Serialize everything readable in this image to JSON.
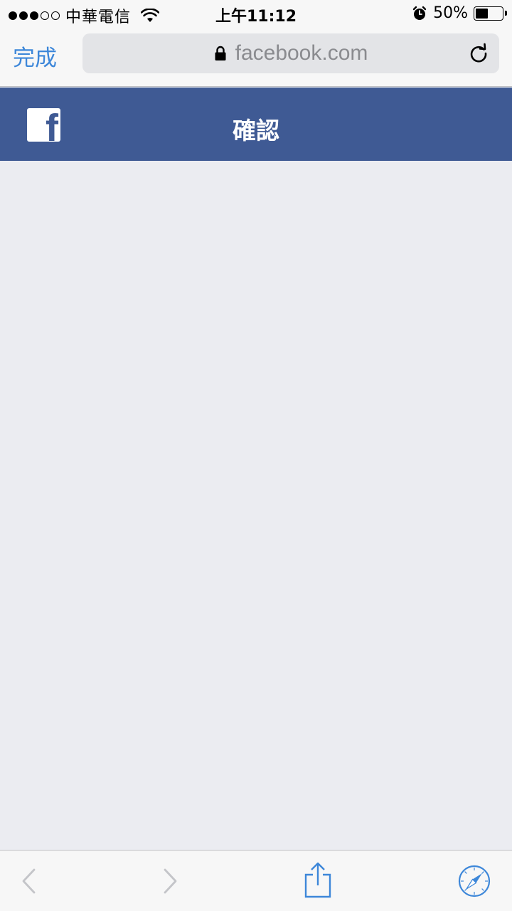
{
  "status_bar": {
    "carrier": "中華電信",
    "time": "上午11:12",
    "battery_percent": "50%",
    "battery_level": 0.5,
    "signal_bars_filled": 3,
    "signal_bars_total": 5
  },
  "address_bar": {
    "done_label": "完成",
    "url": "facebook.com"
  },
  "header": {
    "title": "確認",
    "logo_letter": "f",
    "background_color": "#3f5a94"
  },
  "toolbar": {
    "icons": [
      "back-icon",
      "forward-icon",
      "share-icon",
      "compass-icon"
    ],
    "accent_color": "#3d87d9"
  }
}
